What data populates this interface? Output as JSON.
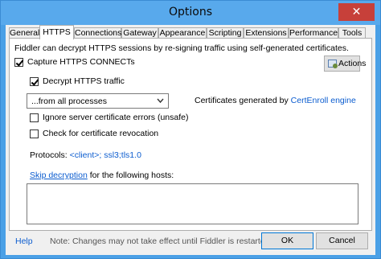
{
  "window": {
    "title": "Options",
    "close_glyph": "✕"
  },
  "tabs": [
    {
      "label": "General"
    },
    {
      "label": "HTTPS",
      "active": true
    },
    {
      "label": "Connections"
    },
    {
      "label": "Gateway"
    },
    {
      "label": "Appearance"
    },
    {
      "label": "Scripting"
    },
    {
      "label": "Extensions"
    },
    {
      "label": "Performance"
    },
    {
      "label": "Tools"
    }
  ],
  "https": {
    "description": "Fiddler can decrypt HTTPS sessions by re-signing traffic using self-generated certificates.",
    "capture_connects": {
      "label": "Capture HTTPS CONNECTs",
      "checked": true
    },
    "actions_button": "Actions",
    "decrypt_traffic": {
      "label": "Decrypt HTTPS traffic",
      "checked": true
    },
    "process_filter": "...from all processes",
    "certs_prefix": "Certificates generated by ",
    "certs_link": "CertEnroll engine",
    "ignore_errors": {
      "label": "Ignore server certificate errors (unsafe)",
      "checked": false
    },
    "check_revocation": {
      "label": "Check for certificate revocation",
      "checked": false
    },
    "protocols_label": "Protocols: ",
    "protocols_value": "<client>; ssl3;tls1.0",
    "skip_link": "Skip decryption",
    "skip_suffix": " for the following hosts:",
    "hosts_value": ""
  },
  "footer": {
    "help": "Help",
    "note": "Note: Changes may not take effect until Fiddler is restarted.",
    "ok": "OK",
    "cancel": "Cancel"
  },
  "colors": {
    "titlebar": "#58a9ec",
    "link": "#0b5ccf",
    "close": "#c7403a"
  }
}
